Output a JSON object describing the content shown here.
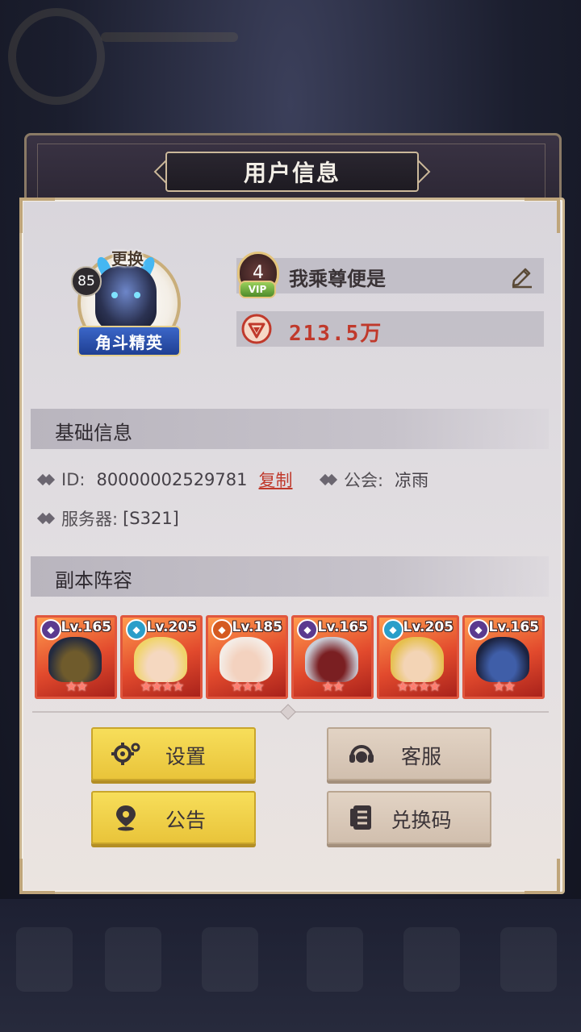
{
  "window": {
    "title": "用户信息"
  },
  "profile": {
    "change_label": "更换",
    "level": "85",
    "rank_title": "角斗精英",
    "vip_level": "4",
    "vip_tag": "VIP",
    "player_name": "我乘尊便是",
    "power": "213.5万"
  },
  "basic_info": {
    "header": "基础信息",
    "id_label": "ID:",
    "id_value": "80000002529781",
    "copy_label": "复制",
    "guild_label": "公会:",
    "guild_value": "凉雨",
    "server_label": "服务器:",
    "server_value": "[S321]"
  },
  "lineup": {
    "header": "副本阵容",
    "heroes": [
      {
        "level": "Lv.165",
        "stars": "★★",
        "type_icon": "dark-faction-icon",
        "type_color": "#5b3a8f",
        "hair": "#232a3f",
        "skin": "#6f5b2c"
      },
      {
        "level": "Lv.205",
        "stars": "★★★★",
        "type_icon": "light-faction-icon",
        "type_color": "#2a9ec9",
        "hair": "#f0d46a",
        "skin": "#f5d8c0"
      },
      {
        "level": "Lv.185",
        "stars": "★★★",
        "type_icon": "fire-faction-icon",
        "type_color": "#d55a21",
        "hair": "#f4ece6",
        "skin": "#f3d2bf"
      },
      {
        "level": "Lv.165",
        "stars": "★★",
        "type_icon": "dark-faction-icon",
        "type_color": "#5b3a8f",
        "hair": "#c9ccd6",
        "skin": "#7a1f22"
      },
      {
        "level": "Lv.205",
        "stars": "★★★★",
        "type_icon": "light-faction-icon",
        "type_color": "#2a9ec9",
        "hair": "#e6c04f",
        "skin": "#f3d4b5"
      },
      {
        "level": "Lv.165",
        "stars": "★★",
        "type_icon": "dark-faction-icon",
        "type_color": "#5b3a8f",
        "hair": "#1c2340",
        "skin": "#3f5ea8"
      }
    ]
  },
  "actions": {
    "settings": "设置",
    "support": "客服",
    "notice": "公告",
    "redeem": "兑换码"
  },
  "colors": {
    "accent_red": "#c0392b",
    "button_yellow": "#f2d24c",
    "button_beige": "#dccbbb"
  }
}
